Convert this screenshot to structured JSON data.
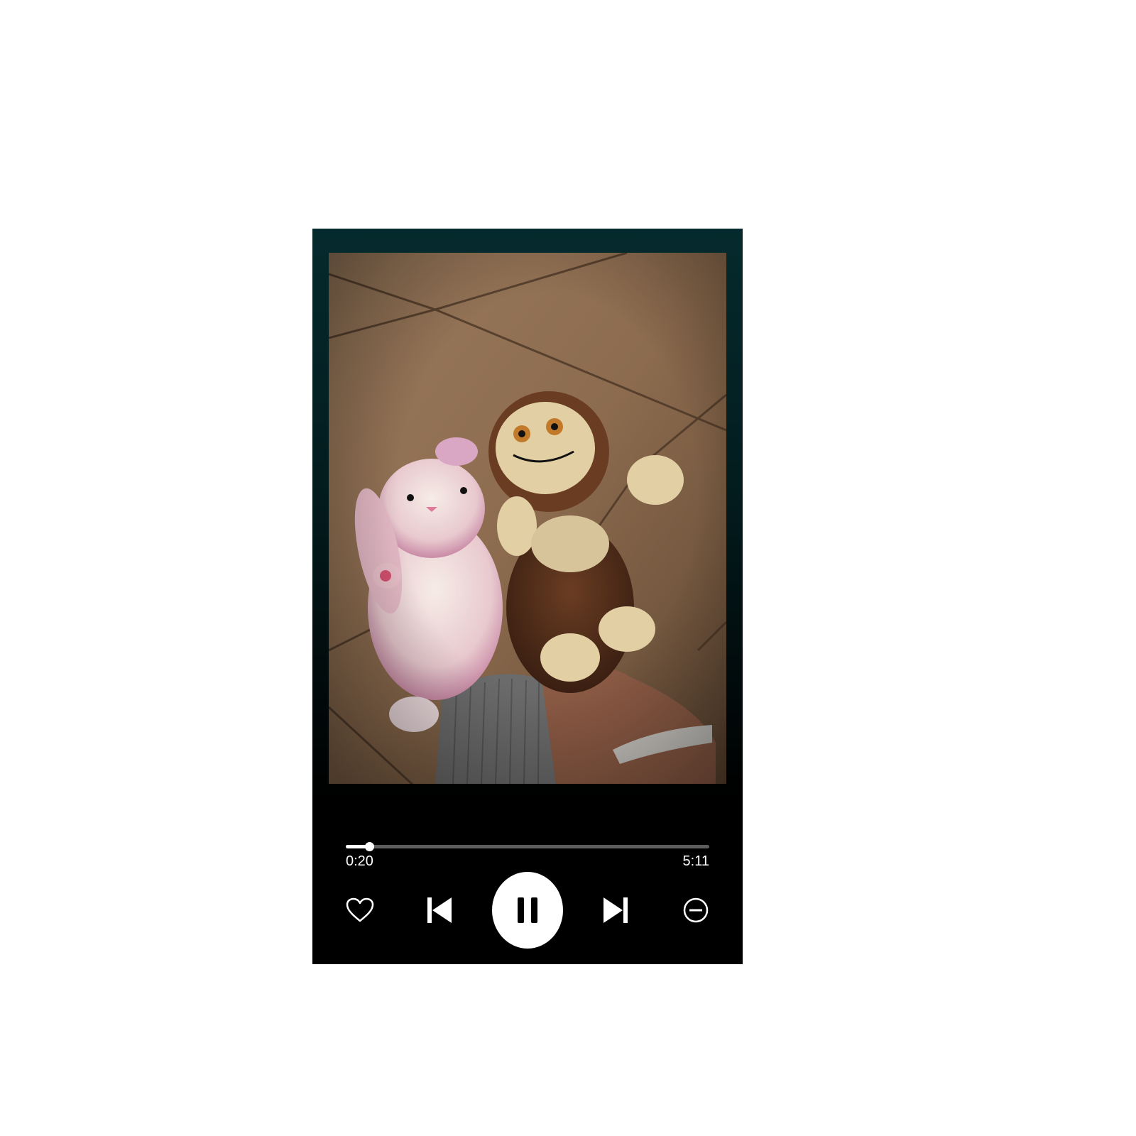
{
  "player": {
    "artwork": {
      "subject": "two-plush-toys-photo"
    },
    "progress": {
      "fraction": 0.064,
      "elapsed": "0:20",
      "total": "5:11"
    },
    "controls": {
      "like_icon": "heart-outline-icon",
      "prev_icon": "skip-previous-icon",
      "play_icon": "pause-icon",
      "next_icon": "skip-next-icon",
      "remove_icon": "minus-circle-icon"
    },
    "colors": {
      "top_gradient": "#052a2d",
      "bottom": "#000000",
      "track": "#5e5e5e",
      "accent": "#ffffff"
    }
  }
}
